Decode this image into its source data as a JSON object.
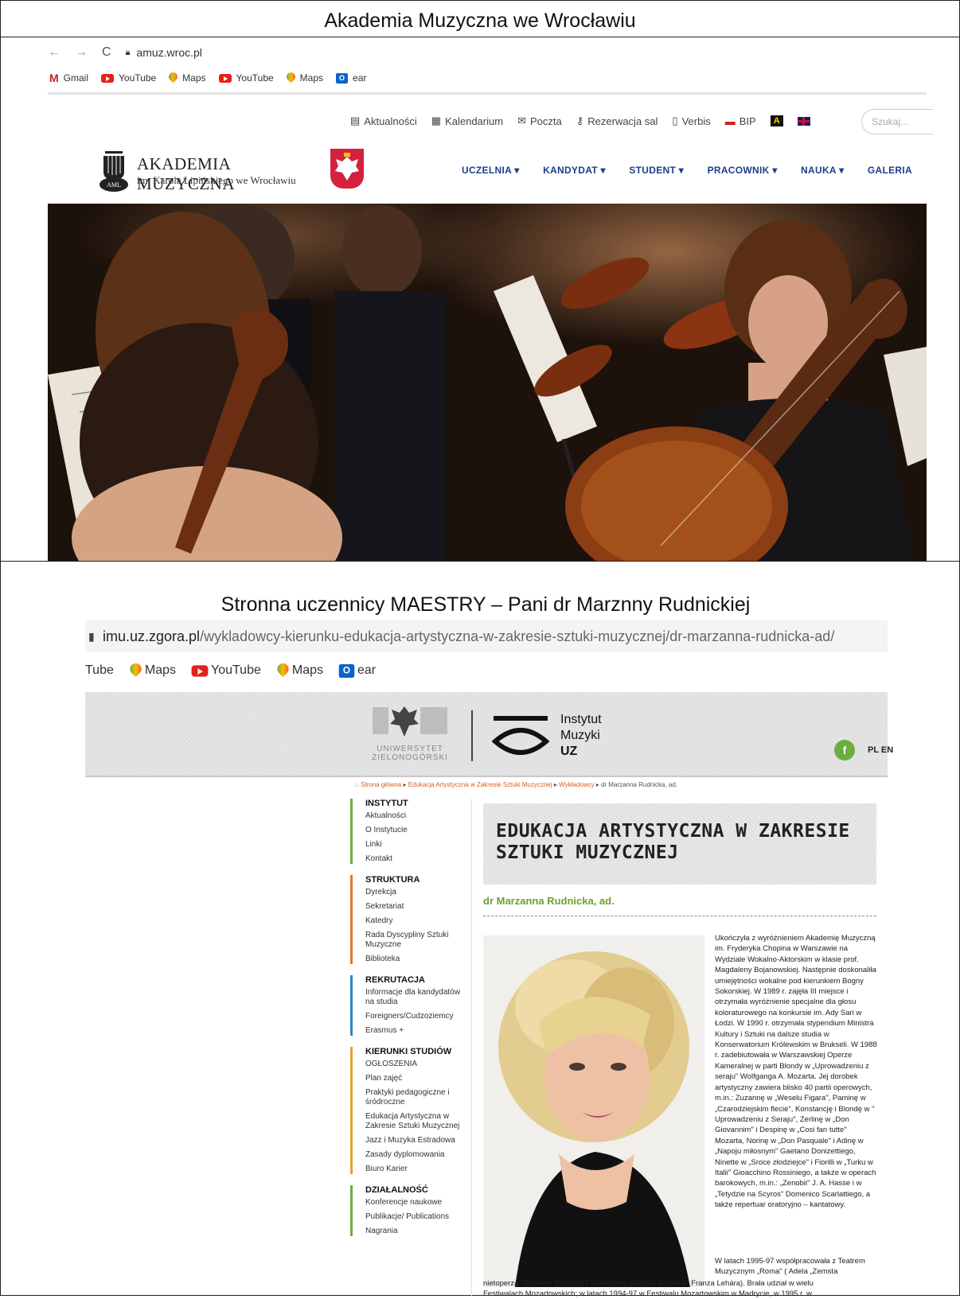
{
  "top": {
    "heading": "Akademia Muzyczna we Wrocławiu",
    "url": "amuz.wroc.pl",
    "bookmarks": [
      "Gmail",
      "YouTube",
      "Maps",
      "YouTube",
      "Maps",
      "ear"
    ],
    "top_links": [
      "Aktualności",
      "Kalendarium",
      "Poczta",
      "Rezerwacja sal",
      "Verbis",
      "BIP"
    ],
    "search_placeholder": "Szukaj...",
    "logo_title": "AKADEMIA MUZYCZNA",
    "logo_sub": "im. Karola Lipińskiego we Wrocławiu",
    "main_nav": [
      "UCZELNIA ▾",
      "KANDYDAT ▾",
      "STUDENT ▾",
      "PRACOWNIK ▾",
      "NAUKA ▾",
      "GALERIA"
    ]
  },
  "bottom": {
    "heading": "Stronna uczennicy MAESTRY – Pani dr Marznny Rudnickiej",
    "url_domain": "imu.uz.zgora.pl",
    "url_path": "/wykladowcy-kierunku-edukacja-artystyczna-w-zakresie-sztuki-muzycznej/dr-marzanna-rudnicka-ad/",
    "bookmarks": [
      "Tube",
      "Maps",
      "YouTube",
      "Maps",
      "ear"
    ],
    "uz_logo_line1": "UNIWERSYTET",
    "uz_logo_line2": "ZIELONOGÓRSKI",
    "institute": [
      "Instytut",
      "Muzyki",
      "UZ"
    ],
    "lang": "PL EN",
    "breadcrumb": [
      "Strona główna",
      "Edukacja Artystyczna w Zakresie Sztuki Muzycznej",
      "Wykładowcy",
      "dr Marzanna Rudnicka, ad."
    ],
    "sidebar": [
      {
        "title": "INSTYTUT",
        "color": "#6cae3e",
        "items": [
          "Aktualności",
          "O Instytucie",
          "Linki",
          "Kontakt"
        ]
      },
      {
        "title": "STRUKTURA",
        "color": "#e2782a",
        "items": [
          "Dyrekcja",
          "Sekretariat",
          "Katedry",
          "Rada Dyscypliny Sztuki Muzyczne",
          "Biblioteka"
        ]
      },
      {
        "title": "REKRUTACJA",
        "color": "#2f86c9",
        "items": [
          "Informacje dla kandydatów na studia",
          "Foreigners/Cudzoziemcy",
          "Erasmus +"
        ]
      },
      {
        "title": "KIERUNKI STUDIÓW",
        "color": "#e0a626",
        "items": [
          "OGŁOSZENIA",
          "Plan zajęć",
          "Praktyki pedagogiczne i śródroczne",
          "Edukacja Artystyczna w Zakresie Sztuki Muzycznej",
          "Jazz i Muzyka Estradowa",
          "Zasady dyplomowania",
          "Biuro Karier"
        ]
      },
      {
        "title": "DZIAŁALNOŚĆ",
        "color": "#6cae3e",
        "items": [
          "Konferencje naukowe",
          "Publikacje/ Publications",
          "Nagrania"
        ]
      }
    ],
    "page_title": "EDUKACJA ARTYSTYCZNA W ZAKRESIE SZTUKI MUZYCZNEJ",
    "person": "dr Marzanna Rudnicka, ad.",
    "bio": "Ukończyła z wyróżnieniem Akademię Muzyczną im. Fryderyka Chopina w Warszawie na Wydziale Wokalno-Aktorskim w klasie prof. Magdaleny Bojanowskiej. Następnie doskonaliła umiejętności wokalne pod kierunkiem Bogny Sokorskiej. W 1989 r. zajęła III miejsce i otrzymała wyróżnienie specjalne dla głosu koloraturowego na konkursie im. Ady Sari w Łodzi. W 1990 r. otrzymała stypendium Ministra Kultury i Sztuki na dalsze studia w Konserwatorium Królewskim w Brukseli. W 1988 r. zadebiutowała w Warszawskiej Operze Kameralnej w parti Blondy w „Uprowadzeniu z seraju\" Wolfganga A. Mozarta. Jej dorobek artystyczny zawiera blisko 40 partii operowych, m.in.: Zuzannę w „Weselu Figara\", Paminę w „Czarodziejskim flecie\", Konstancję i Blondę w \" Uprowadzeniu z Seraju\", Zerlinę w „Don Giovannim\" i Despinę w „Cosi fan tutte\" Mozarta, Norinę w „Don Pasquale\" i Adinę w „Napoju miłosnym\" Gaetano Donizettiego, Ninette w „Sroce złodziejce\" i Fiorilli w „Turku w Italii\" Gioacchino Rossiniego, a także w operach barokowych, m.in.: „Zenobii\" J. A. Hasse i w „Tetydzie na Scyros\" Domenico Scarlattiego, a także repertuar oratoryjno – kantatowy.",
    "bio2a": "W latach 1995-97 współpracowała z Teatrem Muzycznym „Roma\" ( Adela „Zemsta",
    "bio2b": "nietoperza\" Johanna Straussa i Walentyna „Wesoła Wdówka\" Franza Lehára). Brała udział w wielu",
    "bio2c": "Festiwalach Mozartowskich; w latach 1994-97 w Festiwalu Mozartowskim w Madrycie, w 1995 r. w"
  }
}
